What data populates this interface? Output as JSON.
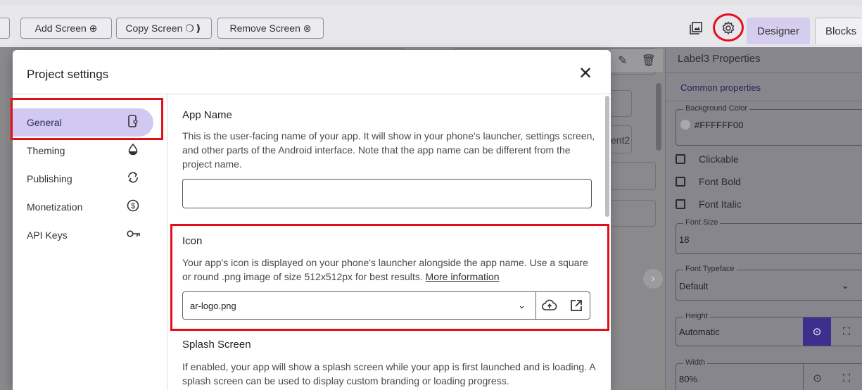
{
  "toolbar": {
    "add_screen": "Add Screen ⊕",
    "copy_screen": "Copy Screen ❍❫",
    "remove_screen": "Remove Screen ⊗",
    "tab_designer": "Designer",
    "tab_blocks": "Blocks"
  },
  "background": {
    "component_label": "ent2"
  },
  "properties": {
    "title": "Label3 Properties",
    "section": "Common properties",
    "background_color": {
      "label": "Background Color",
      "value": "#FFFFFF00"
    },
    "checkboxes": [
      "Clickable",
      "Font Bold",
      "Font Italic"
    ],
    "font_size": {
      "label": "Font Size",
      "value": "18"
    },
    "font_typeface": {
      "label": "Font Typeface",
      "value": "Default"
    },
    "height": {
      "label": "Height",
      "value": "Automatic"
    },
    "width": {
      "label": "Width",
      "value": "80%"
    }
  },
  "modal": {
    "title": "Project settings",
    "close": "✕",
    "nav": [
      {
        "label": "General",
        "icon": "phone-settings-icon"
      },
      {
        "label": "Theming",
        "icon": "drop-icon"
      },
      {
        "label": "Publishing",
        "icon": "sync-icon"
      },
      {
        "label": "Monetization",
        "icon": "dollar-icon"
      },
      {
        "label": "API Keys",
        "icon": "key-icon"
      }
    ],
    "app_name": {
      "title": "App Name",
      "description": "This is the user-facing name of your app. It will show in your phone's launcher, settings screen, and other parts of the Android interface. Note that the app name can be different from the project name.",
      "value": ""
    },
    "icon": {
      "title": "Icon",
      "description": "Your app's icon is displayed on your phone's launcher alongside the app name. Use a square or round .png image of size 512x512px for best results.",
      "link": "More information",
      "value": "ar-logo.png"
    },
    "splash": {
      "title": "Splash Screen",
      "description": "If enabled, your app will show a splash screen while your app is first launched and is loading. A splash screen can be used to display custom branding or loading progress."
    }
  },
  "colors": {
    "accent": "#3c2f8e",
    "active_nav": "#d2c9f2",
    "highlight": "#e3101c"
  }
}
